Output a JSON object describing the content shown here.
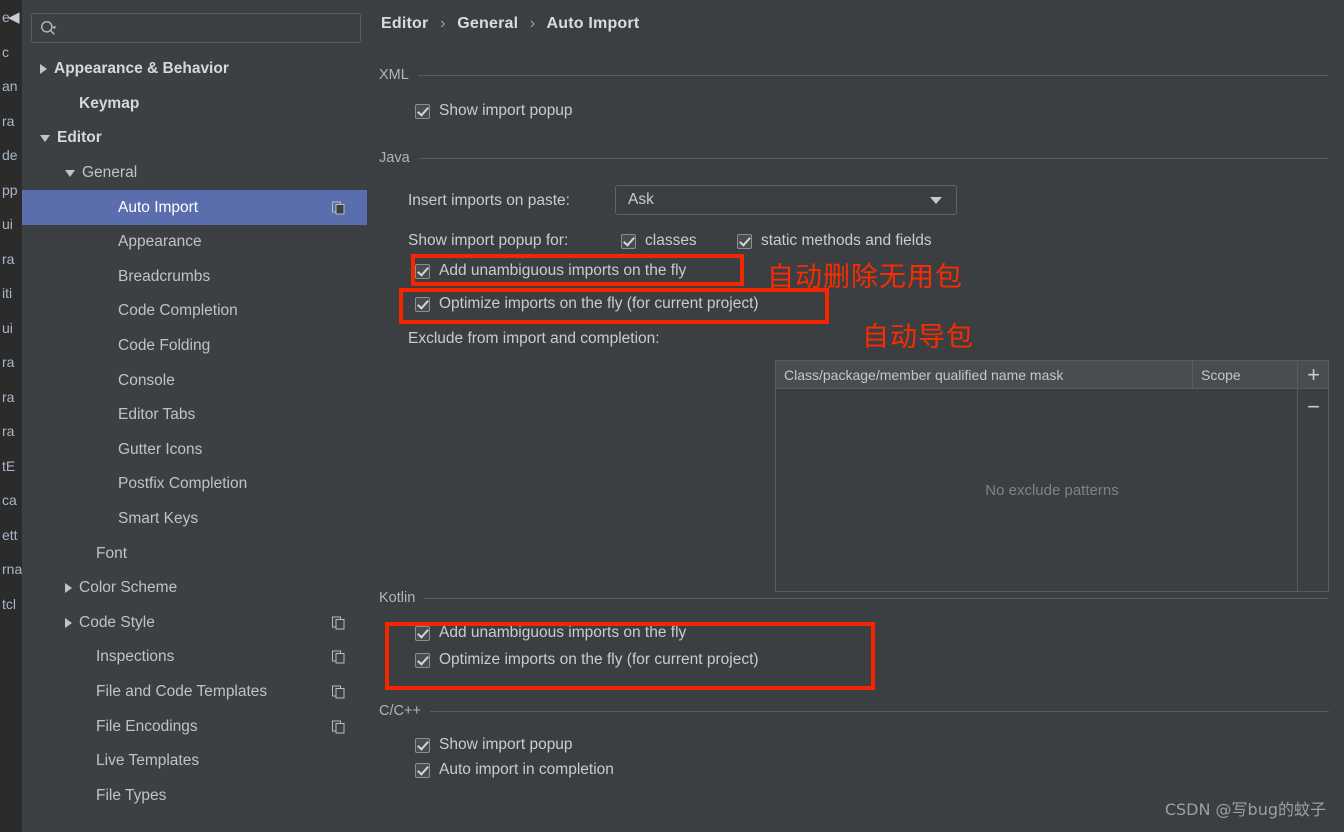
{
  "background_editor": {
    "lines": [
      "e",
      "c",
      "an",
      "ra",
      "de",
      "pp",
      "ui",
      "ra",
      "iti",
      "ui",
      "ra",
      "ra",
      "ra",
      "tE",
      "ca",
      "ett",
      "rna",
      "tcl"
    ],
    "collapse_icon": "◀"
  },
  "sidebar": {
    "search": {
      "placeholder": "",
      "value": "",
      "icon": "search-icon"
    },
    "items": [
      {
        "label": "Appearance & Behavior",
        "indent": 18,
        "twisty": "right",
        "bold": true,
        "selected": false,
        "copy": false
      },
      {
        "label": "Keymap",
        "indent": 43,
        "twisty": "none",
        "bold": true,
        "selected": false,
        "copy": false
      },
      {
        "label": "Editor",
        "indent": 18,
        "twisty": "down",
        "bold": true,
        "selected": false,
        "copy": false
      },
      {
        "label": "General",
        "indent": 43,
        "twisty": "down",
        "bold": false,
        "selected": false,
        "copy": false
      },
      {
        "label": "Auto Import",
        "indent": 82,
        "twisty": "none",
        "bold": false,
        "selected": true,
        "copy": true
      },
      {
        "label": "Appearance",
        "indent": 82,
        "twisty": "none",
        "bold": false,
        "selected": false,
        "copy": false
      },
      {
        "label": "Breadcrumbs",
        "indent": 82,
        "twisty": "none",
        "bold": false,
        "selected": false,
        "copy": false
      },
      {
        "label": "Code Completion",
        "indent": 82,
        "twisty": "none",
        "bold": false,
        "selected": false,
        "copy": false
      },
      {
        "label": "Code Folding",
        "indent": 82,
        "twisty": "none",
        "bold": false,
        "selected": false,
        "copy": false
      },
      {
        "label": "Console",
        "indent": 82,
        "twisty": "none",
        "bold": false,
        "selected": false,
        "copy": false
      },
      {
        "label": "Editor Tabs",
        "indent": 82,
        "twisty": "none",
        "bold": false,
        "selected": false,
        "copy": false
      },
      {
        "label": "Gutter Icons",
        "indent": 82,
        "twisty": "none",
        "bold": false,
        "selected": false,
        "copy": false
      },
      {
        "label": "Postfix Completion",
        "indent": 82,
        "twisty": "none",
        "bold": false,
        "selected": false,
        "copy": false
      },
      {
        "label": "Smart Keys",
        "indent": 82,
        "twisty": "none",
        "bold": false,
        "selected": false,
        "copy": false
      },
      {
        "label": "Font",
        "indent": 60,
        "twisty": "none",
        "bold": false,
        "selected": false,
        "copy": false
      },
      {
        "label": "Color Scheme",
        "indent": 43,
        "twisty": "right",
        "bold": false,
        "selected": false,
        "copy": false
      },
      {
        "label": "Code Style",
        "indent": 43,
        "twisty": "right",
        "bold": false,
        "selected": false,
        "copy": true
      },
      {
        "label": "Inspections",
        "indent": 60,
        "twisty": "none",
        "bold": false,
        "selected": false,
        "copy": true
      },
      {
        "label": "File and Code Templates",
        "indent": 60,
        "twisty": "none",
        "bold": false,
        "selected": false,
        "copy": true
      },
      {
        "label": "File Encodings",
        "indent": 60,
        "twisty": "none",
        "bold": false,
        "selected": false,
        "copy": true
      },
      {
        "label": "Live Templates",
        "indent": 60,
        "twisty": "none",
        "bold": false,
        "selected": false,
        "copy": false
      },
      {
        "label": "File Types",
        "indent": 60,
        "twisty": "none",
        "bold": false,
        "selected": false,
        "copy": false
      }
    ]
  },
  "breadcrumb": {
    "part1": "Editor",
    "part2": "General",
    "part3": "Auto Import",
    "separator": "›"
  },
  "sections": {
    "xml": {
      "label": "XML",
      "show_import_popup": {
        "label": "Show import popup",
        "checked": true
      }
    },
    "java": {
      "label": "Java",
      "insert_imports_label": "Insert imports on paste:",
      "insert_imports_value": "Ask",
      "show_popup_for_label": "Show import popup for:",
      "popup_classes": {
        "label": "classes",
        "checked": true
      },
      "popup_static": {
        "label": "static methods and fields",
        "checked": true
      },
      "add_unambiguous": {
        "label": "Add unambiguous imports on the fly",
        "checked": true
      },
      "optimize_imports": {
        "label": "Optimize imports on the fly (for current project)",
        "checked": true
      },
      "exclude_label": "Exclude from import and completion:",
      "table": {
        "columns": [
          "Class/package/member qualified name mask",
          "Scope"
        ],
        "rows": [],
        "empty_text": "No exclude patterns",
        "add_button": "+",
        "remove_button": "−"
      }
    },
    "kotlin": {
      "label": "Kotlin",
      "add_unambiguous": {
        "label": "Add unambiguous imports on the fly",
        "checked": true
      },
      "optimize_imports": {
        "label": "Optimize imports on the fly (for current project)",
        "checked": true
      }
    },
    "ccpp": {
      "label": "C/C++",
      "show_import_popup": {
        "label": "Show import popup",
        "checked": true
      },
      "auto_import_completion": {
        "label": "Auto import in completion",
        "checked": true
      }
    }
  },
  "annotations": {
    "note_delete_unused": "自动删除无用包",
    "note_auto_import": "自动导包",
    "highlight_color": "#f42700"
  },
  "watermark": "CSDN @写bug的蚊子"
}
